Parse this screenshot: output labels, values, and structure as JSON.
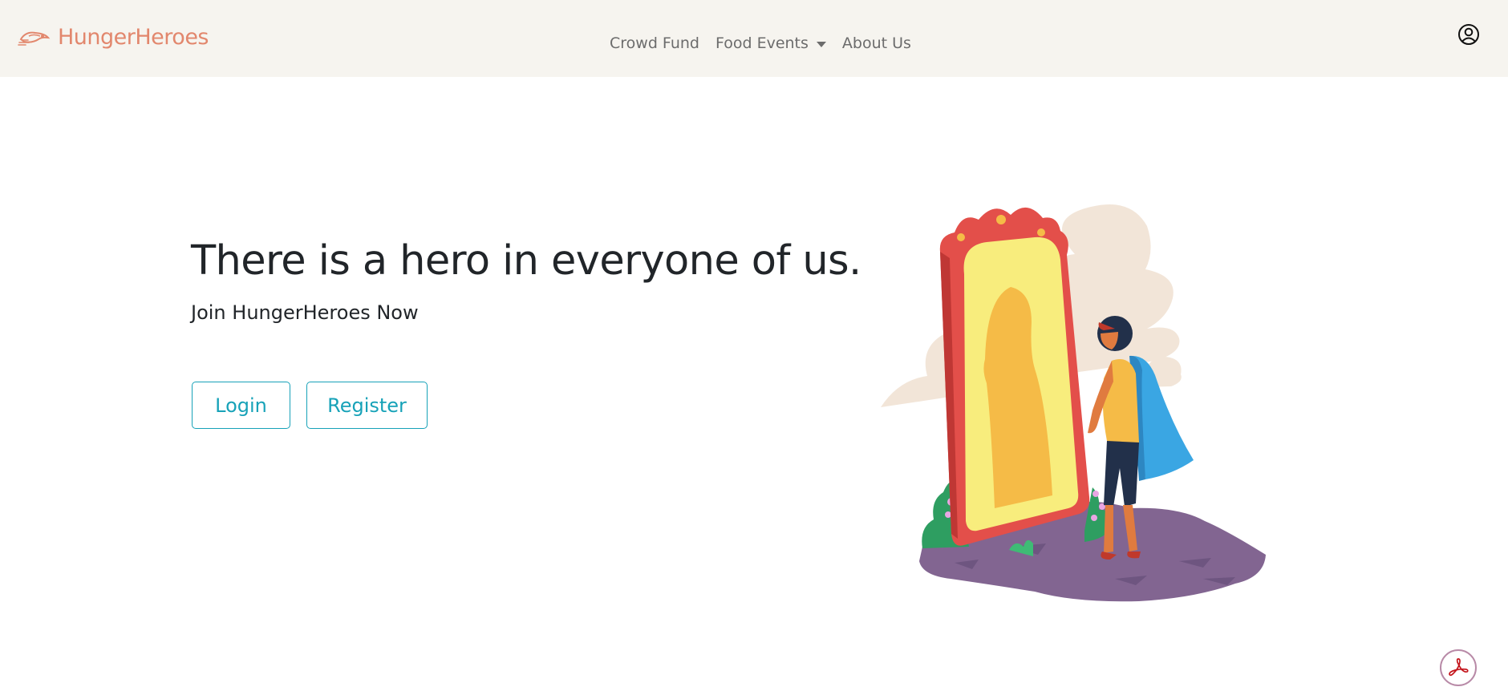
{
  "header": {
    "brand_name": "HungerHeroes",
    "brand_icon": "hero-logo-icon",
    "nav": [
      {
        "label": "Crowd Fund"
      },
      {
        "label": "Food Events",
        "has_dropdown": true
      },
      {
        "label": "About Us"
      }
    ],
    "profile_icon": "user-circle-icon"
  },
  "hero": {
    "title": "There is a hero in everyone of us.",
    "subtitle": "Join HungerHeroes Now",
    "login_label": "Login",
    "register_label": "Register",
    "illustration": "hero-mirror-illustration"
  },
  "floating": {
    "pdf_icon": "adobe-acrobat-icon"
  },
  "colors": {
    "navbar_bg": "#f6f4ef",
    "brand": "#e2876d",
    "accent": "#17a2b8",
    "text": "#212529"
  }
}
